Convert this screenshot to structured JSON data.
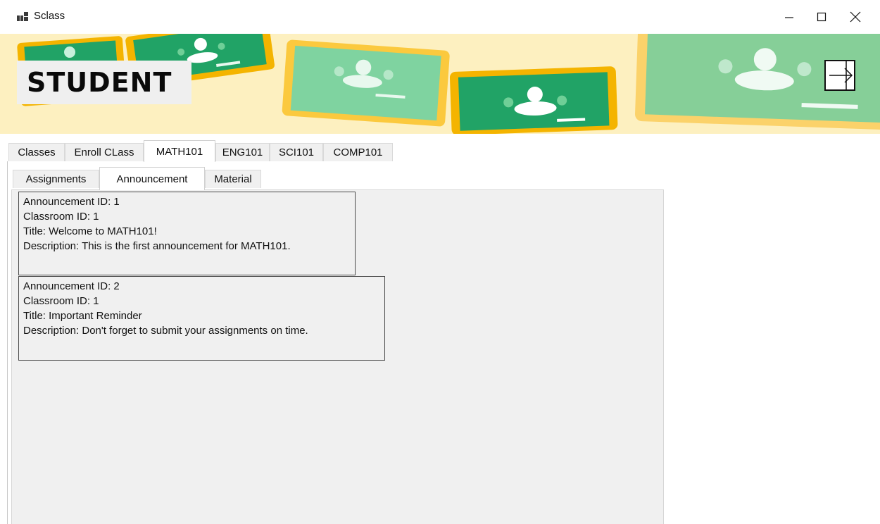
{
  "window": {
    "title": "Sclass",
    "controls": [
      "minimize",
      "maximize",
      "close"
    ]
  },
  "banner": {
    "heading": "STUDENT",
    "logout_icon": "logout-arrow-icon",
    "colors": {
      "background": "#fdf0c0",
      "board": "#21a366",
      "frame": "#f4b400"
    }
  },
  "main_tabs": [
    {
      "label": "Classes",
      "active": false
    },
    {
      "label": "Enroll CLass",
      "active": false
    },
    {
      "label": "MATH101",
      "active": true
    },
    {
      "label": "ENG101",
      "active": false
    },
    {
      "label": "SCI101",
      "active": false
    },
    {
      "label": "COMP101",
      "active": false
    }
  ],
  "sub_tabs": [
    {
      "label": "Assignments",
      "active": false
    },
    {
      "label": "Announcement",
      "active": true
    },
    {
      "label": "Material",
      "active": false
    }
  ],
  "announcements": [
    {
      "id_line": "Announcement ID: 1",
      "classroom_line": "Classroom ID: 1",
      "title_line": "Title: Welcome to MATH101!",
      "description_line": "Description: This is the first announcement for MATH101."
    },
    {
      "id_line": "Announcement ID: 2",
      "classroom_line": "Classroom ID: 1",
      "title_line": "Title: Important Reminder",
      "description_line": "Description: Don't forget to submit your assignments on time."
    }
  ]
}
